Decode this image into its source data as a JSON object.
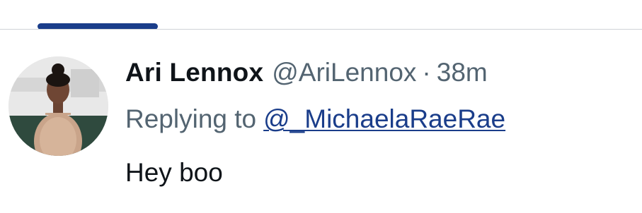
{
  "tweet": {
    "display_name": "Ari Lennox",
    "handle": "@AriLennox",
    "separator": "·",
    "time": "38m",
    "replying_to_label": "Replying to",
    "replying_to_handle": "@_MichaelaRaeRae",
    "text": "Hey boo"
  },
  "colors": {
    "tab_indicator": "#1a3d8a",
    "mention_link": "#1a3d8a",
    "secondary_text": "#536471",
    "primary_text": "#0f1419"
  }
}
